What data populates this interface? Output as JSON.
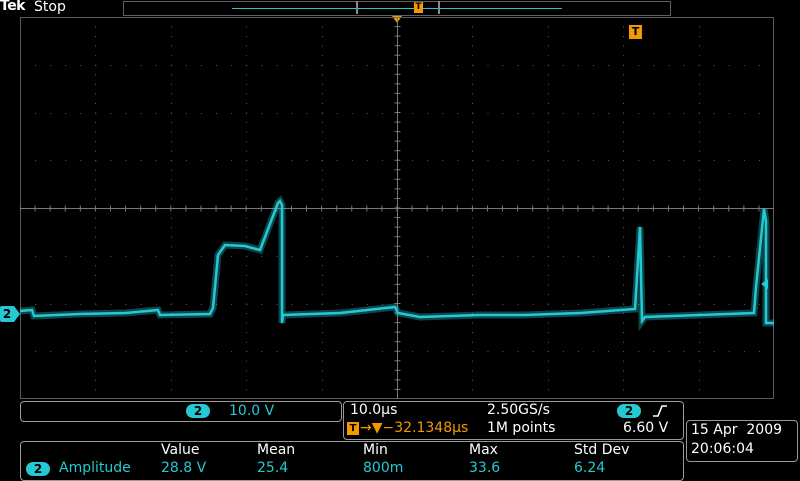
{
  "top_bar": {
    "brand": "Tek",
    "run_state": "Stop",
    "trigger_marker": "T"
  },
  "trigger_marker": "T",
  "channel_marker": "2",
  "channel_scale": {
    "channel": "2",
    "volts_per_div": "10.0 V"
  },
  "acquisition": {
    "time_per_div": "10.0µs",
    "sample_rate": "2.50GS/s",
    "trigger_offset_icon": "T",
    "trigger_offset": "→▼−32.1348µs",
    "record_length": "1M points",
    "trigger_channel": "2",
    "trigger_slope_icon": "rising-edge-icon",
    "trigger_level": "6.60 V"
  },
  "measurement": {
    "headers": [
      "Value",
      "Mean",
      "Min",
      "Max",
      "Std Dev"
    ],
    "channel": "2",
    "name": "Amplitude",
    "values": [
      "28.8 V",
      "25.4",
      "800m",
      "33.6",
      "6.24"
    ]
  },
  "datetime": {
    "date": "15 Apr  2009",
    "time": "20:06:04"
  },
  "colors": {
    "trace": "#25c9d3",
    "trigger": "#f39a00",
    "graticule": "#5a5a5a",
    "background": "#000000"
  }
}
